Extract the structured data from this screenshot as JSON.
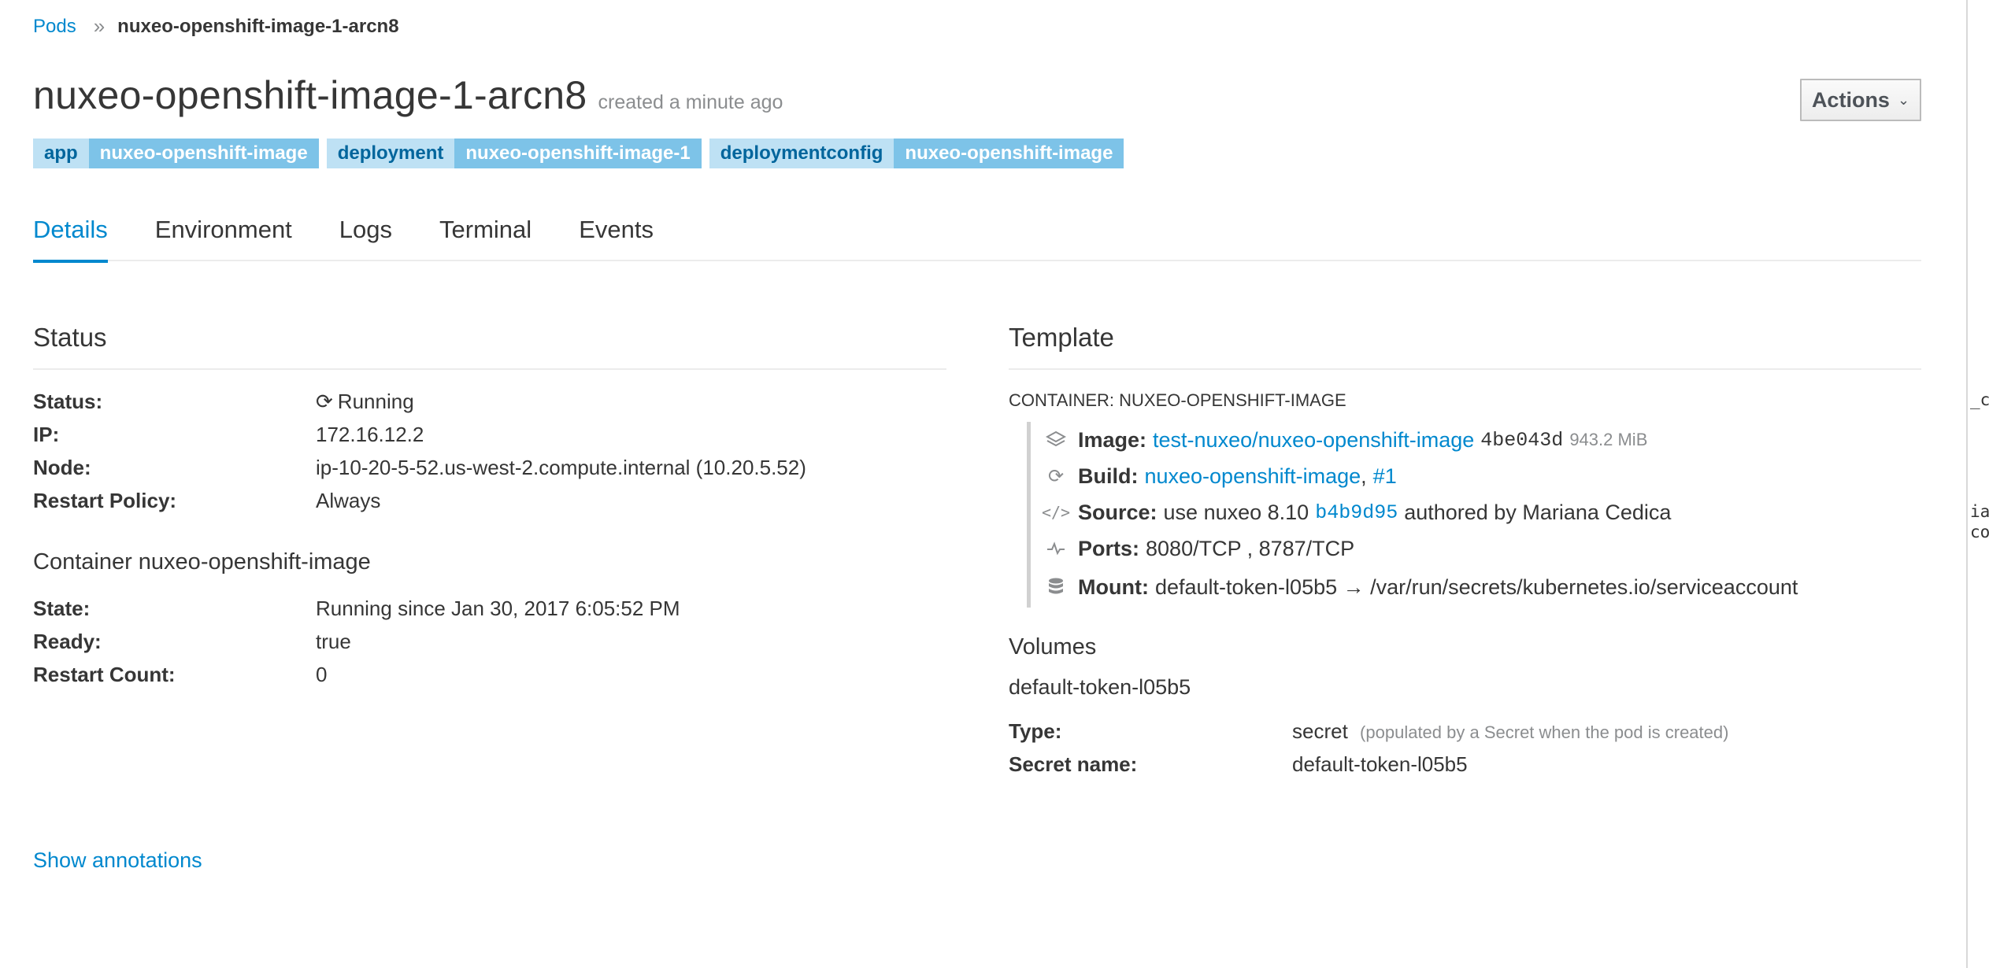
{
  "breadcrumb": {
    "parent": "Pods",
    "current": "nuxeo-openshift-image-1-arcn8"
  },
  "header": {
    "title": "nuxeo-openshift-image-1-arcn8",
    "created": "created a minute ago",
    "actions_label": "Actions"
  },
  "labels": [
    {
      "key": "app",
      "value": "nuxeo-openshift-image"
    },
    {
      "key": "deployment",
      "value": "nuxeo-openshift-image-1"
    },
    {
      "key": "deploymentconfig",
      "value": "nuxeo-openshift-image"
    }
  ],
  "tabs": [
    {
      "label": "Details",
      "active": true
    },
    {
      "label": "Environment"
    },
    {
      "label": "Logs"
    },
    {
      "label": "Terminal"
    },
    {
      "label": "Events"
    }
  ],
  "status": {
    "heading": "Status",
    "rows": [
      {
        "label": "Status:",
        "value": "Running"
      },
      {
        "label": "IP:",
        "value": "172.16.12.2"
      },
      {
        "label": "Node:",
        "value": "ip-10-20-5-52.us-west-2.compute.internal (10.20.5.52)"
      },
      {
        "label": "Restart Policy:",
        "value": "Always"
      }
    ],
    "container_heading": "Container nuxeo-openshift-image",
    "container_rows": [
      {
        "label": "State:",
        "value": "Running since Jan 30, 2017 6:05:52 PM"
      },
      {
        "label": "Ready:",
        "value": "true"
      },
      {
        "label": "Restart Count:",
        "value": "0"
      }
    ]
  },
  "template": {
    "heading": "Template",
    "container_caption": "CONTAINER: NUXEO-OPENSHIFT-IMAGE",
    "image": {
      "label": "Image:",
      "link": "test-nuxeo/nuxeo-openshift-image",
      "digest": "4be043d",
      "size": "943.2 MiB"
    },
    "build": {
      "label": "Build:",
      "link": "nuxeo-openshift-image",
      "sep": ",",
      "number": "#1"
    },
    "source": {
      "label": "Source:",
      "text": "use nuxeo 8.10",
      "commit": "b4b9d95",
      "author": "authored by Mariana Cedica"
    },
    "ports": {
      "label": "Ports:",
      "value": "8080/TCP , 8787/TCP"
    },
    "mount": {
      "label": "Mount:",
      "value": "default-token-l05b5 → /var/run/secrets/kubernetes.io/serviceaccount"
    }
  },
  "volumes": {
    "heading": "Volumes",
    "name": "default-token-l05b5",
    "type_label": "Type:",
    "type_value": "secret",
    "type_note": "(populated by a Secret when the pod is created)",
    "secret_label": "Secret name:",
    "secret_value": "default-token-l05b5"
  },
  "show_annotations": "Show annotations",
  "right_strip": [
    "_c",
    "ia",
    "co"
  ],
  "colors": {
    "link": "#0088ce",
    "label_key_bg": "#bee1f4",
    "label_value_bg": "#7dc3e8"
  }
}
